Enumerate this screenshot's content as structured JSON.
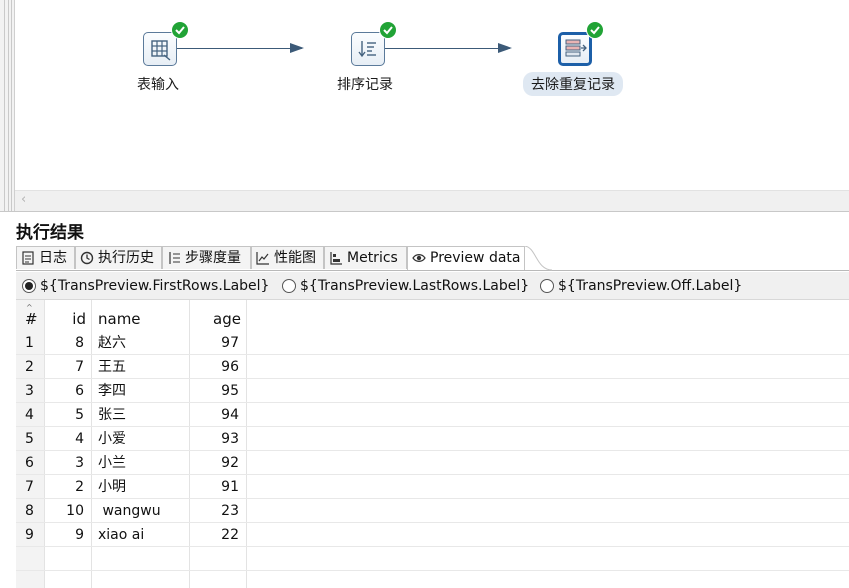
{
  "canvas": {
    "steps": [
      {
        "label": "表输入",
        "icon": "table-input-icon"
      },
      {
        "label": "排序记录",
        "icon": "sort-rows-icon"
      },
      {
        "label": "去除重复记录",
        "icon": "unique-rows-icon",
        "selected": true
      }
    ],
    "scroll_left": "‹"
  },
  "results": {
    "title": "执行结果",
    "tabs": [
      {
        "label": "日志",
        "icon": "log-icon"
      },
      {
        "label": "执行历史",
        "icon": "history-icon"
      },
      {
        "label": "步骤度量",
        "icon": "step-metrics-icon"
      },
      {
        "label": "性能图",
        "icon": "performance-chart-icon"
      },
      {
        "label": "Metrics",
        "icon": "metrics-icon"
      },
      {
        "label": "Preview data",
        "icon": "eye-icon",
        "active": true
      }
    ],
    "radio_options": [
      {
        "label": "${TransPreview.FirstRows.Label}",
        "checked": true
      },
      {
        "label": "${TransPreview.LastRows.Label}",
        "checked": false
      },
      {
        "label": "${TransPreview.Off.Label}",
        "checked": false
      }
    ]
  },
  "table": {
    "headers": {
      "num": "#",
      "id": "id",
      "name": "name",
      "age": "age"
    },
    "rows": [
      {
        "num": "1",
        "id": "8",
        "name": "赵六",
        "age": "97"
      },
      {
        "num": "2",
        "id": "7",
        "name": "王五",
        "age": "96"
      },
      {
        "num": "3",
        "id": "6",
        "name": "李四",
        "age": "95"
      },
      {
        "num": "4",
        "id": "5",
        "name": "张三",
        "age": "94"
      },
      {
        "num": "5",
        "id": "4",
        "name": "小爱",
        "age": "93"
      },
      {
        "num": "6",
        "id": "3",
        "name": "小兰",
        "age": "92"
      },
      {
        "num": "7",
        "id": "2",
        "name": "小明",
        "age": "91"
      },
      {
        "num": "8",
        "id": "10",
        "name": " wangwu",
        "age": "23"
      },
      {
        "num": "9",
        "id": "9",
        "name": "xiao ai",
        "age": "22"
      }
    ]
  },
  "colors": {
    "accent": "#1c5fa8",
    "success": "#21a336",
    "hop": "#3c5a78"
  }
}
